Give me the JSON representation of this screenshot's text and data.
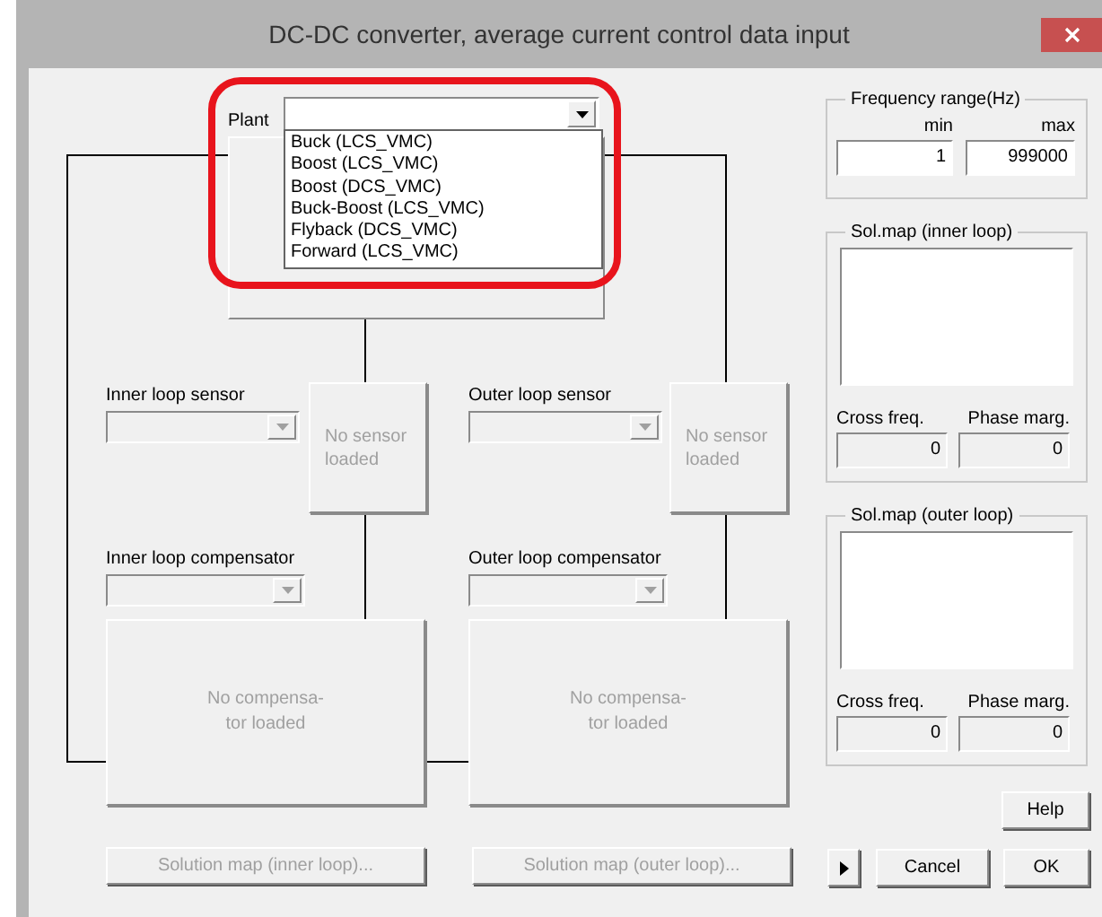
{
  "window": {
    "title": "DC-DC converter, average current control data input"
  },
  "plant": {
    "label": "Plant",
    "expanded": true,
    "options": [
      "Buck (LCS_VMC)",
      "Boost (LCS_VMC)",
      "Boost (DCS_VMC)",
      "Buck-Boost (LCS_VMC)",
      "Flyback (DCS_VMC)",
      "Forward (LCS_VMC)"
    ]
  },
  "sensors": [
    {
      "label": "Inner loop sensor",
      "disabled": true,
      "box_text": "No sensor loaded"
    },
    {
      "label": "Outer loop sensor",
      "disabled": true,
      "box_text": "No sensor loaded"
    }
  ],
  "compensators": [
    {
      "label": "Inner loop compensator",
      "disabled": true,
      "box_text": "No compensa-\ntor loaded"
    },
    {
      "label": "Outer loop compensator",
      "disabled": true,
      "box_text": "No compensa-\ntor loaded"
    }
  ],
  "solution_buttons": [
    {
      "label": "Solution map (inner loop)...",
      "disabled": true
    },
    {
      "label": "Solution map (outer loop)...",
      "disabled": true
    }
  ],
  "frequency": {
    "title": "Frequency range(Hz)",
    "min_label": "min",
    "max_label": "max",
    "min": "1",
    "max": "999000"
  },
  "sol_maps": [
    {
      "title": "Sol.map (inner loop)",
      "cross_label": "Cross freq.",
      "phase_label": "Phase marg.",
      "cross": "0",
      "phase": "0"
    },
    {
      "title": "Sol.map (outer loop)",
      "cross_label": "Cross freq.",
      "phase_label": "Phase marg.",
      "cross": "0",
      "phase": "0"
    }
  ],
  "buttons": {
    "help": "Help",
    "cancel": "Cancel",
    "ok": "OK"
  }
}
